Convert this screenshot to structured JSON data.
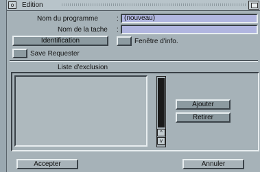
{
  "window": {
    "title": "Edition",
    "close_glyph": "o"
  },
  "form": {
    "program_name_label": "Nom du programme",
    "program_name_value": "(nouveau)",
    "task_name_label": "Nom de la tache",
    "task_name_value": ""
  },
  "options": {
    "identification_label": "Identification",
    "info_window_label": "Fenêtre d'info.",
    "save_requester_label": "Save Requester"
  },
  "exclusion": {
    "title": "Liste d'exclusion",
    "items": [],
    "add_button": "Ajouter",
    "remove_button": "Retirer",
    "scroll_up_glyph": "^",
    "scroll_down_glyph": "v"
  },
  "footer": {
    "accept_button": "Accepter",
    "cancel_button": "Annuler"
  }
}
